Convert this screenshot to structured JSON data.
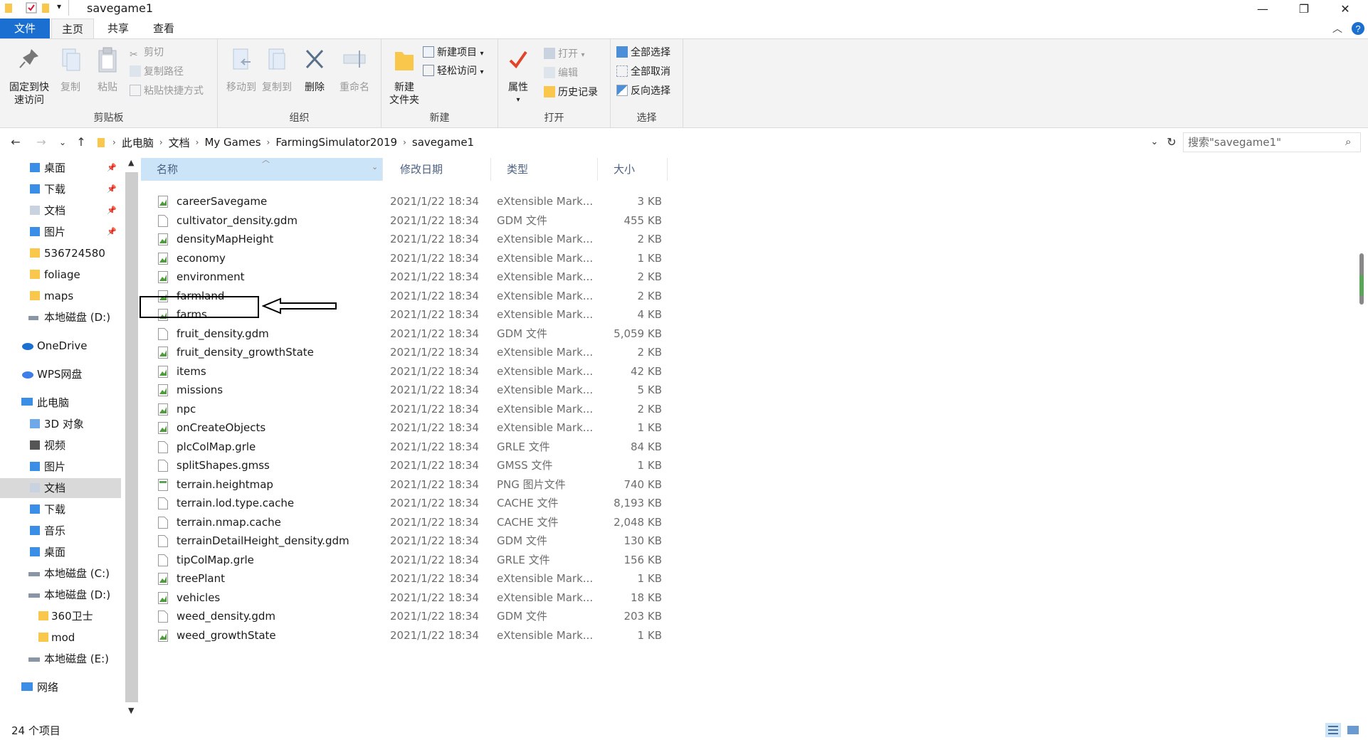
{
  "window": {
    "title": "savegame1",
    "minimize": "—",
    "restore": "❐",
    "close": "✕"
  },
  "tabs": [
    "文件",
    "主页",
    "共享",
    "查看"
  ],
  "ribbon": {
    "clipboard": {
      "label": "剪贴板",
      "pin_line1": "固定到快",
      "pin_line2": "速访问",
      "copy": "复制",
      "paste": "粘贴",
      "cut": "剪切",
      "copy_path": "复制路径",
      "paste_shortcut": "粘贴快捷方式"
    },
    "organize": {
      "label": "组织",
      "move_to": "移动到",
      "copy_to": "复制到",
      "delete": "删除",
      "rename": "重命名"
    },
    "new": {
      "label": "新建",
      "new_folder_line1": "新建",
      "new_folder_line2": "文件夹",
      "new_item": "新建项目",
      "easy_access": "轻松访问"
    },
    "open": {
      "label": "打开",
      "properties": "属性",
      "open": "打开",
      "edit": "编辑",
      "history": "历史记录"
    },
    "select": {
      "label": "选择",
      "select_all": "全部选择",
      "select_none": "全部取消",
      "invert": "反向选择"
    }
  },
  "address": {
    "crumbs": [
      "此电脑",
      "文档",
      "My Games",
      "FarmingSimulator2019",
      "savegame1"
    ],
    "search_placeholder": "搜索\"savegame1\""
  },
  "sidebar": {
    "quick": [
      {
        "label": "桌面",
        "pinned": true
      },
      {
        "label": "下载",
        "pinned": true
      },
      {
        "label": "文档",
        "pinned": true
      },
      {
        "label": "图片",
        "pinned": true
      },
      {
        "label": "536724580",
        "pinned": false
      },
      {
        "label": "foliage",
        "pinned": false
      },
      {
        "label": "maps",
        "pinned": false
      },
      {
        "label": "本地磁盘 (D:)",
        "pinned": false
      }
    ],
    "onedrive": "OneDrive",
    "wps": "WPS网盘",
    "pc": "此电脑",
    "pc_items": [
      "3D 对象",
      "视频",
      "图片",
      "文档",
      "下载",
      "音乐",
      "桌面",
      "本地磁盘 (C:)",
      "本地磁盘 (D:)"
    ],
    "d_items": [
      "360卫士",
      "mod"
    ],
    "e_drive": "本地磁盘 (E:)",
    "network": "网络",
    "selected": "文档"
  },
  "columns": {
    "name": "名称",
    "date": "修改日期",
    "type": "类型",
    "size": "大小"
  },
  "files": [
    {
      "name": "careerSavegame",
      "date": "2021/1/22 18:34",
      "type": "eXtensible Mark...",
      "size": "3 KB",
      "icon": "xml"
    },
    {
      "name": "cultivator_density.gdm",
      "date": "2021/1/22 18:34",
      "type": "GDM 文件",
      "size": "455 KB",
      "icon": "blank"
    },
    {
      "name": "densityMapHeight",
      "date": "2021/1/22 18:34",
      "type": "eXtensible Mark...",
      "size": "2 KB",
      "icon": "xml"
    },
    {
      "name": "economy",
      "date": "2021/1/22 18:34",
      "type": "eXtensible Mark...",
      "size": "1 KB",
      "icon": "xml"
    },
    {
      "name": "environment",
      "date": "2021/1/22 18:34",
      "type": "eXtensible Mark...",
      "size": "2 KB",
      "icon": "xml"
    },
    {
      "name": "farmland",
      "date": "2021/1/22 18:34",
      "type": "eXtensible Mark...",
      "size": "2 KB",
      "icon": "xml"
    },
    {
      "name": "farms",
      "date": "2021/1/22 18:34",
      "type": "eXtensible Mark...",
      "size": "4 KB",
      "icon": "xml"
    },
    {
      "name": "fruit_density.gdm",
      "date": "2021/1/22 18:34",
      "type": "GDM 文件",
      "size": "5,059 KB",
      "icon": "blank"
    },
    {
      "name": "fruit_density_growthState",
      "date": "2021/1/22 18:34",
      "type": "eXtensible Mark...",
      "size": "2 KB",
      "icon": "xml"
    },
    {
      "name": "items",
      "date": "2021/1/22 18:34",
      "type": "eXtensible Mark...",
      "size": "42 KB",
      "icon": "xml"
    },
    {
      "name": "missions",
      "date": "2021/1/22 18:34",
      "type": "eXtensible Mark...",
      "size": "5 KB",
      "icon": "xml"
    },
    {
      "name": "npc",
      "date": "2021/1/22 18:34",
      "type": "eXtensible Mark...",
      "size": "2 KB",
      "icon": "xml"
    },
    {
      "name": "onCreateObjects",
      "date": "2021/1/22 18:34",
      "type": "eXtensible Mark...",
      "size": "1 KB",
      "icon": "xml"
    },
    {
      "name": "plcColMap.grle",
      "date": "2021/1/22 18:34",
      "type": "GRLE 文件",
      "size": "84 KB",
      "icon": "blank"
    },
    {
      "name": "splitShapes.gmss",
      "date": "2021/1/22 18:34",
      "type": "GMSS 文件",
      "size": "1 KB",
      "icon": "blank"
    },
    {
      "name": "terrain.heightmap",
      "date": "2021/1/22 18:34",
      "type": "PNG 图片文件",
      "size": "740 KB",
      "icon": "png"
    },
    {
      "name": "terrain.lod.type.cache",
      "date": "2021/1/22 18:34",
      "type": "CACHE 文件",
      "size": "8,193 KB",
      "icon": "blank"
    },
    {
      "name": "terrain.nmap.cache",
      "date": "2021/1/22 18:34",
      "type": "CACHE 文件",
      "size": "2,048 KB",
      "icon": "blank"
    },
    {
      "name": "terrainDetailHeight_density.gdm",
      "date": "2021/1/22 18:34",
      "type": "GDM 文件",
      "size": "130 KB",
      "icon": "blank"
    },
    {
      "name": "tipColMap.grle",
      "date": "2021/1/22 18:34",
      "type": "GRLE 文件",
      "size": "156 KB",
      "icon": "blank"
    },
    {
      "name": "treePlant",
      "date": "2021/1/22 18:34",
      "type": "eXtensible Mark...",
      "size": "1 KB",
      "icon": "xml"
    },
    {
      "name": "vehicles",
      "date": "2021/1/22 18:34",
      "type": "eXtensible Mark...",
      "size": "18 KB",
      "icon": "xml"
    },
    {
      "name": "weed_density.gdm",
      "date": "2021/1/22 18:34",
      "type": "GDM 文件",
      "size": "203 KB",
      "icon": "blank"
    },
    {
      "name": "weed_growthState",
      "date": "2021/1/22 18:34",
      "type": "eXtensible Mark...",
      "size": "1 KB",
      "icon": "xml"
    }
  ],
  "status": {
    "count": "24 个项目"
  },
  "colors": {
    "accent": "#1a6fd0",
    "folder": "#f8c74c",
    "header_sel": "#cce4f7",
    "sidebar_sel": "#d9d9d9"
  }
}
